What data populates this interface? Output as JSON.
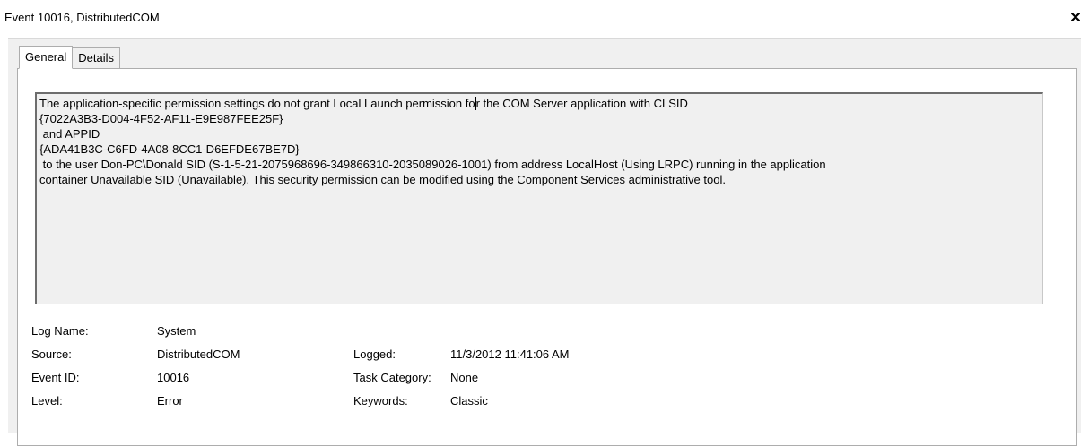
{
  "window": {
    "title": "Event 10016, DistributedCOM",
    "close_glyph": "✕"
  },
  "tabs": [
    {
      "label": "General",
      "active": true
    },
    {
      "label": "Details",
      "active": false
    }
  ],
  "description": {
    "line1_before_caret": "The application-specific permission settings do not grant Local Launch permission fo",
    "line1_after_caret": "r the COM Server application with CLSID",
    "lines": [
      "{7022A3B3-D004-4F52-AF11-E9E987FEE25F}",
      " and APPID",
      "{ADA41B3C-C6FD-4A08-8CC1-D6EFDE67BE7D}",
      " to the user Don-PC\\Donald SID (S-1-5-21-2075968696-349866310-2035089026-1001) from address LocalHost (Using LRPC) running in the application",
      "container Unavailable SID (Unavailable). This security permission can be modified using the Component Services administrative tool."
    ]
  },
  "fields": {
    "log_name": {
      "label": "Log Name:",
      "value": "System"
    },
    "source": {
      "label": "Source:",
      "value": "DistributedCOM"
    },
    "logged": {
      "label": "Logged:",
      "value": "11/3/2012 11:41:06 AM"
    },
    "event_id": {
      "label": "Event ID:",
      "value": "10016"
    },
    "task_category": {
      "label": "Task Category:",
      "value": "None"
    },
    "level": {
      "label": "Level:",
      "value": "Error"
    },
    "keywords": {
      "label": "Keywords:",
      "value": "Classic"
    }
  }
}
